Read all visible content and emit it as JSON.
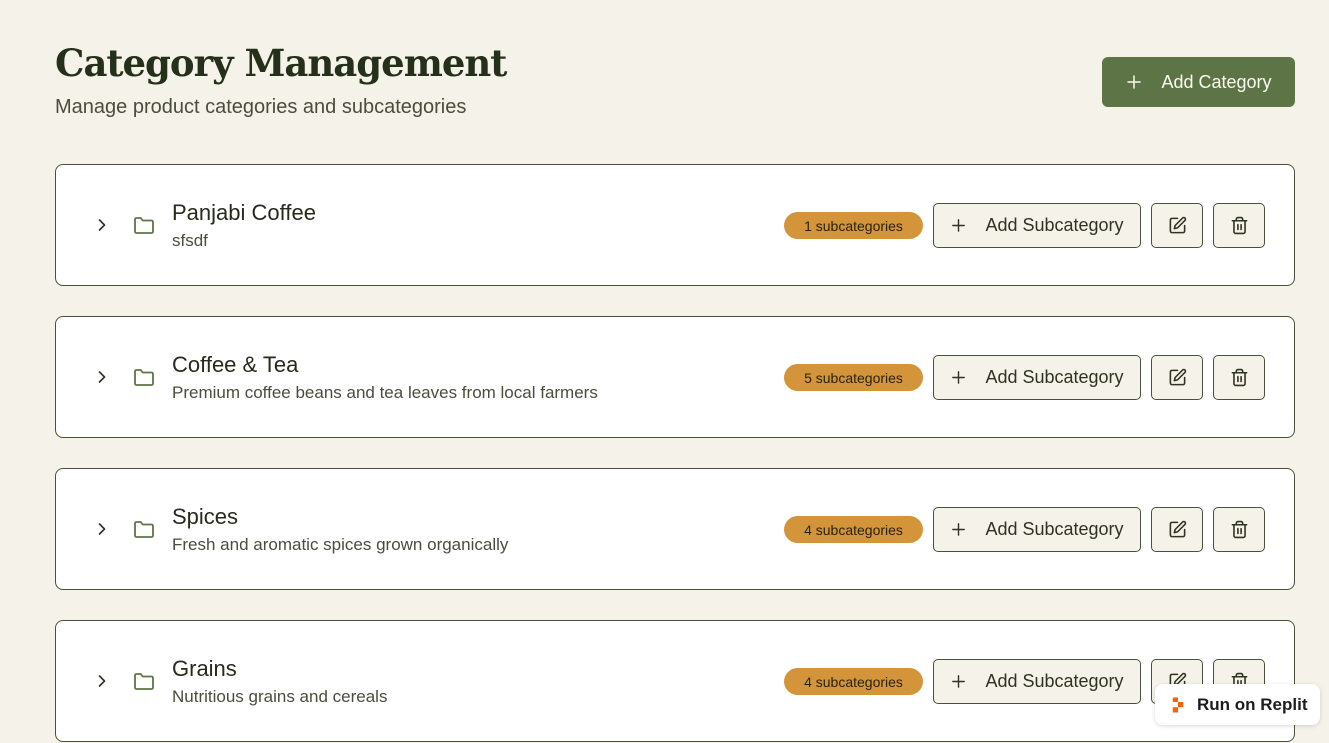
{
  "header": {
    "title": "Category Management",
    "subtitle": "Manage product categories and subcategories",
    "add_button_label": "Add Category"
  },
  "categories": [
    {
      "name": "Panjabi Coffee",
      "description": "sfsdf",
      "badge": "1 subcategories",
      "add_sub_label": "Add Subcategory"
    },
    {
      "name": "Coffee & Tea",
      "description": "Premium coffee beans and tea leaves from local farmers",
      "badge": "5 subcategories",
      "add_sub_label": "Add Subcategory"
    },
    {
      "name": "Spices",
      "description": "Fresh and aromatic spices grown organically",
      "badge": "4 subcategories",
      "add_sub_label": "Add Subcategory"
    },
    {
      "name": "Grains",
      "description": "Nutritious grains and cereals",
      "badge": "4 subcategories",
      "add_sub_label": "Add Subcategory"
    }
  ],
  "replit": {
    "label": "Run on Replit"
  },
  "icons": {
    "chevron": "chevron-right-icon",
    "folder": "folder-icon",
    "plus": "plus-icon",
    "edit": "edit-icon",
    "delete": "trash-icon",
    "replit": "replit-logo-icon"
  },
  "colors": {
    "background": "#f5f2e9",
    "primary": "#5d7447",
    "badge": "#d4943a",
    "border": "#49513a",
    "replit_orange": "#f26207"
  }
}
